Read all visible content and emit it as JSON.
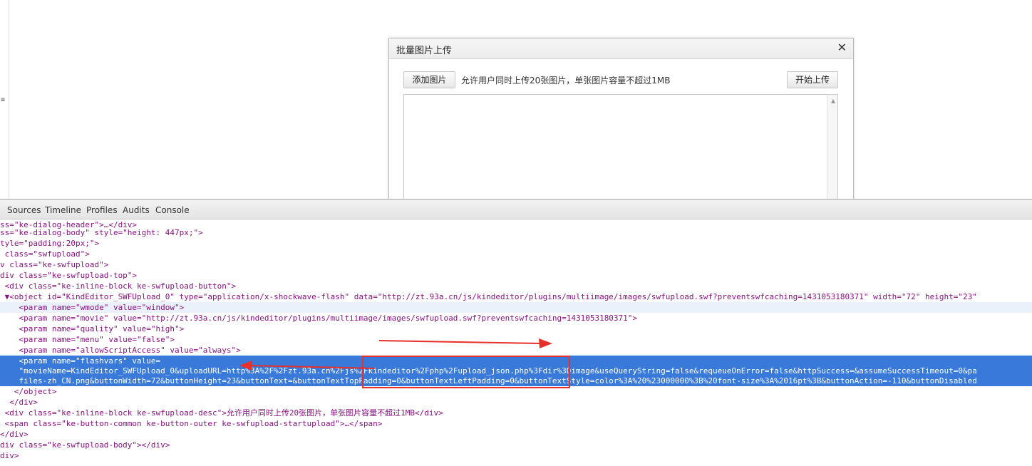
{
  "dialog": {
    "title": "批量图片上传",
    "close_glyph": "✕",
    "add_button": "添加图片",
    "description": "允许用户同时上传20张图片，单张图片容量不超过1MB",
    "start_button": "开始上传"
  },
  "devtools": {
    "tabs": [
      "Sources",
      "Timeline",
      "Profiles",
      "Audits",
      "Console"
    ],
    "lines": [
      "ss=\"ke-dialog-header\">…</div>",
      "ss=\"ke-dialog-body\" style=\"height: 447px;\">",
      "tyle=\"padding:20px;\">",
      " class=\"swfupload\">",
      "v class=\"ke-swfupload\">",
      "div class=\"ke-swfupload-top\">",
      " <div class=\"ke-inline-block ke-swfupload-button\">",
      " ▼<object id=\"KindEditor_SWFUpload_0\" type=\"application/x-shockwave-flash\" data=\"http://zt.93a.cn/js/kindeditor/plugins/multiimage/images/swfupload.swf?preventswfcaching=1431053180371\" width=\"72\" height=\"23\"",
      "    <param name=\"wmode\" value=\"window\">",
      "    <param name=\"movie\" value=\"http://zt.93a.cn/js/kindeditor/plugins/multiimage/images/swfupload.swf?preventswfcaching=1431053180371\">",
      "    <param name=\"quality\" value=\"high\">",
      "    <param name=\"menu\" value=\"false\">",
      "    <param name=\"allowScriptAccess\" value=\"always\">",
      "    <param name=\"flashvars\" value=",
      "    \"movieName=KindEditor_SWFUpload_0&uploadURL=http%3A%2F%2Fzt.93a.cn%2Fjs%2Fkindeditor%2Fphp%2Fupload_json.php%3Fdir%3Dimage&useQueryString=false&requeueOnError=false&httpSuccess=&assumeSuccessTimeout=0&pa",
      "    files-zh_CN.png&buttonWidth=72&buttonHeight=23&buttonText=&buttonTextTopPadding=0&buttonTextLeftPadding=0&buttonTextStyle=color%3A%20%23000000%3B%20font-size%3A%2016pt%3B&buttonAction=-110&buttonDisabled",
      "   </object>",
      "  </div>",
      " <div class=\"ke-inline-block ke-swfupload-desc\">允许用户同时上传20张图片，单张图片容量不超过1MB</div>",
      " <span class=\"ke-button-common ke-button-outer ke-swfupload-startupload\">…</span>",
      "</div>",
      "div class=\"ke-swfupload-body\"></div>",
      "div>"
    ]
  },
  "colors": {
    "selection": "#3879d9",
    "annotation": "#e8302a",
    "tag": "#881280"
  }
}
